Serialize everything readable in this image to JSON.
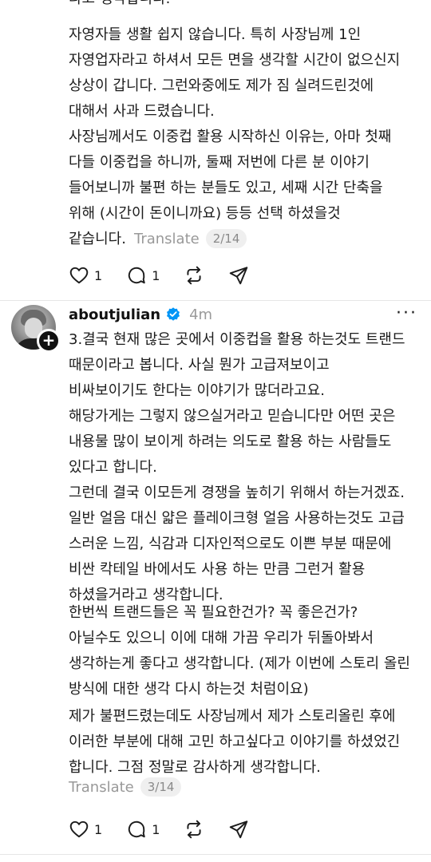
{
  "post1": {
    "paragraphs": [
      "라고 생각합니다.",
      "자영자들 생활 쉽지 않습니다. 특히 사장님께 1인 자영업자라고 하셔서 모든 면을 생각할 시간이 없으신지 상상이 갑니다. 그런와중에도 제가 짐 실려드린것에 대해서 사과 드렸습니다.",
      "사장님께서도 이중컵 활용 시작하신 이유는, 아마 첫째 다들 이중컵을 하니까, 둘째 저번에 다른 분 이야기 들어보니까 불편 하는 분들도 있고, 세째 시간 단축을 위해 (시간이 돈이니까요) 등등 선택 하셨을것 같습니다."
    ],
    "translate_label": "Translate",
    "counter": "2/14",
    "likes": "1",
    "replies": "1"
  },
  "post2": {
    "username": "aboutjulian",
    "timestamp": "4m",
    "more_label": "···",
    "paragraphs": [
      "3.결국 현재 많은 곳에서 이중컵을 활용 하는것도 트랜드 때문이라고 봅니다. 사실 뭔가 고급져보이고 비싸보이기도 한다는 이야기가 많더라고요.\n해당가게는 그렇지 않으실거라고 믿습니다만 어떤 곳은 내용물 많이 보이게 하려는 의도로 활용 하는 사람들도 있다고 합니다.\n그런데 결국 이모든게 경쟁을 높히기 위해서 하는거겠죠. 일반 얼음 대신 얇은 플레이크형 얼음 사용하는것도 고급 스러운 느낌, 식감과 디자인적으로도 이쁜 부분 때문에 비싼 칵테일 바에서도 사용 하는 만큼 그런거 활용 하셨을거라고 생각합니다.",
      "한번씩 트랜드들은 꼭 필요한건가? 꼭 좋은건가? 아닐수도 있으니 이에 대해 가끔 우리가 뒤돌아봐서 생각하는게 좋다고 생각합니다. (제가 이번에 스토리 올린 방식에 대한 생각 다시 하는것 처럼이요)",
      "제가 불편드렸는데도 사장님께서 제가 스토리올린 후에 이러한 부분에 대해 고민 하고싶다고 이야기를 하셨었긴 합니다. 그점 정말로 감사하게 생각합니다."
    ],
    "translate_label": "Translate",
    "counter": "3/14",
    "likes": "1",
    "replies": "1"
  },
  "colors": {
    "text": "#1c1c1c",
    "muted": "#999999",
    "verified": "#0095f6",
    "badge_bg": "#efefef"
  }
}
